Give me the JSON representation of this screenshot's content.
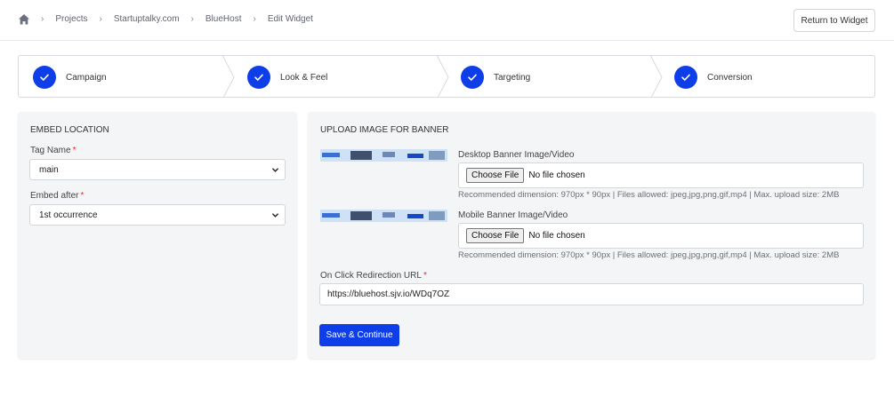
{
  "breadcrumb": {
    "items": [
      "Projects",
      "Startuptalky.com",
      "BlueHost",
      "Edit Widget"
    ]
  },
  "header": {
    "return_button": "Return to Widget"
  },
  "stepper": {
    "steps": [
      {
        "label": "Campaign",
        "status": "complete"
      },
      {
        "label": "Look & Feel",
        "status": "complete"
      },
      {
        "label": "Targeting",
        "status": "complete"
      },
      {
        "label": "Conversion",
        "status": "complete"
      }
    ]
  },
  "embed": {
    "title": "EMBED LOCATION",
    "tag_name_label": "Tag Name",
    "tag_name_value": "main",
    "embed_after_label": "Embed after",
    "embed_after_value": "1st occurrence",
    "required_mark": "*"
  },
  "upload": {
    "title": "UPLOAD IMAGE FOR BANNER",
    "desktop_label": "Desktop Banner Image/Video",
    "mobile_label": "Mobile Banner Image/Video",
    "choose_file": "Choose File",
    "no_file": "No file chosen",
    "hint": "Recommended dimension: 970px * 90px | Files allowed: jpeg,jpg,png,gif,mp4 | Max. upload size: 2MB",
    "url_label": "On Click Redirection URL",
    "url_value": "https://bluehost.sjv.io/WDq7OZ",
    "save_button": "Save & Continue"
  },
  "colors": {
    "primary": "#0d3ee8",
    "required": "#e03535",
    "panel_bg": "#f4f5f7"
  }
}
